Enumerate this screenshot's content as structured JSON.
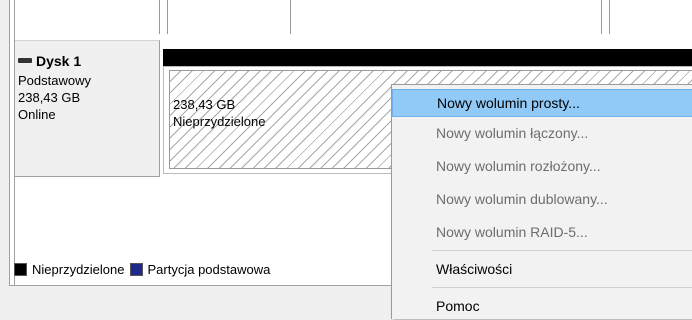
{
  "disk": {
    "name": "Dysk 1",
    "type": "Podstawowy",
    "size": "238,43 GB",
    "status": "Online"
  },
  "partition": {
    "size": "238,43 GB",
    "label": "Nieprzydzielone"
  },
  "legend": {
    "items": [
      {
        "label": "Nieprzydzielone",
        "color": "#000000"
      },
      {
        "label": "Partycja podstawowa",
        "color": "#1e2a8a"
      }
    ]
  },
  "context_menu": {
    "items": [
      {
        "label": "Nowy wolumin prosty...",
        "enabled": true,
        "highlighted": true
      },
      {
        "label": "Nowy wolumin łączony...",
        "enabled": false
      },
      {
        "label": "Nowy wolumin rozłożony...",
        "enabled": false
      },
      {
        "label": "Nowy wolumin dublowany...",
        "enabled": false
      },
      {
        "label": "Nowy wolumin RAID-5...",
        "enabled": false
      },
      {
        "label": "Właściwości",
        "enabled": true
      },
      {
        "label": "Pomoc",
        "enabled": true
      }
    ]
  }
}
